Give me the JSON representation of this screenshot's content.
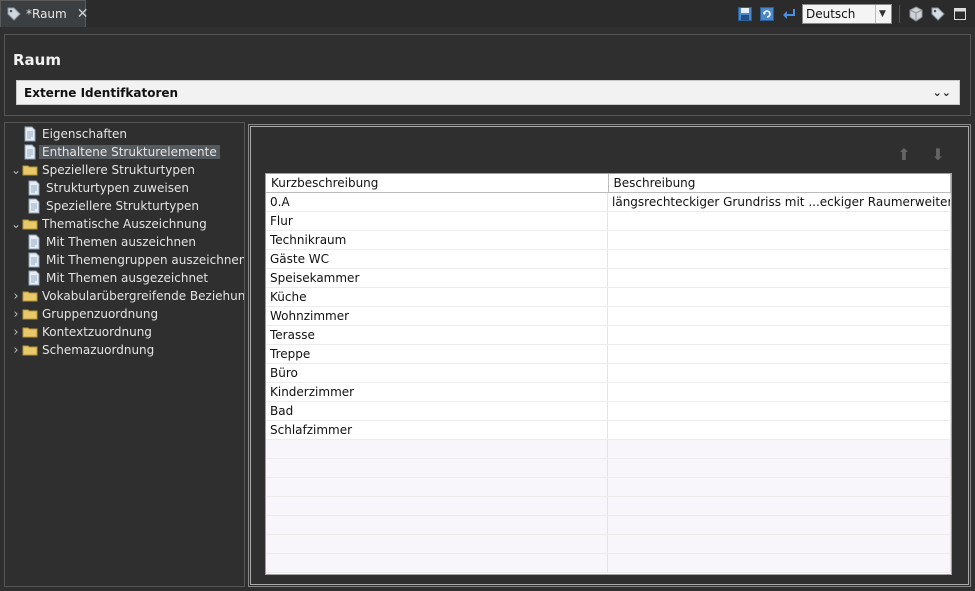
{
  "tab": {
    "title": "*Raum",
    "close_icon": "close-icon",
    "tag_icon": "tag-icon"
  },
  "toolbar": {
    "icons": [
      "save-icon",
      "refresh-icon",
      "undo-icon",
      "cube-icon",
      "tags-icon",
      "maximize-icon"
    ],
    "language": {
      "selected": "Deutsch"
    }
  },
  "header": {
    "title": "Raum",
    "section_label": "Externe Identifkatoren",
    "section_icon": "double-chevron-down-icon"
  },
  "tree": {
    "items": [
      {
        "label": "Eigenschaften",
        "icon": "document-icon",
        "level": 0,
        "twisty": ""
      },
      {
        "label": "Enthaltene Strukturelemente",
        "icon": "document-icon",
        "level": 0,
        "twisty": "",
        "selected": true
      },
      {
        "label": "Speziellere Strukturtypen",
        "icon": "folder-icon",
        "level": 0,
        "twisty": "expanded"
      },
      {
        "label": "Strukturtypen zuweisen",
        "icon": "document-icon",
        "level": 1,
        "twisty": ""
      },
      {
        "label": "Speziellere Strukturtypen",
        "icon": "document-icon",
        "level": 1,
        "twisty": ""
      },
      {
        "label": "Thematische Auszeichnung",
        "icon": "folder-icon",
        "level": 0,
        "twisty": "expanded"
      },
      {
        "label": "Mit Themen auszeichnen",
        "icon": "document-icon",
        "level": 1,
        "twisty": ""
      },
      {
        "label": "Mit Themengruppen auszeichnen",
        "icon": "document-icon",
        "level": 1,
        "twisty": ""
      },
      {
        "label": "Mit Themen ausgezeichnet",
        "icon": "document-icon",
        "level": 1,
        "twisty": ""
      },
      {
        "label": "Vokabularübergreifende Beziehungen",
        "icon": "folder-icon",
        "level": 0,
        "twisty": "collapsed"
      },
      {
        "label": "Gruppenzuordnung",
        "icon": "folder-icon",
        "level": 0,
        "twisty": "collapsed"
      },
      {
        "label": "Kontextzuordnung",
        "icon": "folder-icon",
        "level": 0,
        "twisty": "collapsed"
      },
      {
        "label": "Schemazuordnung",
        "icon": "folder-icon",
        "level": 0,
        "twisty": "collapsed"
      }
    ]
  },
  "main": {
    "move_up_icon": "arrow-up-icon",
    "move_down_icon": "arrow-down-icon",
    "table": {
      "columns": [
        "Kurzbeschreibung",
        "Beschreibung"
      ],
      "rows": [
        [
          "0.A",
          "längsrechteckiger Grundriss mit ...eckiger Raumerweiterung im O"
        ],
        [
          "Flur",
          ""
        ],
        [
          "Technikraum",
          ""
        ],
        [
          "Gäste WC",
          ""
        ],
        [
          "Speisekammer",
          ""
        ],
        [
          "Küche",
          ""
        ],
        [
          "Wohnzimmer",
          ""
        ],
        [
          "Terasse",
          ""
        ],
        [
          "Treppe",
          ""
        ],
        [
          "Büro",
          ""
        ],
        [
          "Kinderzimmer",
          ""
        ],
        [
          "Bad",
          ""
        ],
        [
          "Schlafzimmer",
          ""
        ]
      ]
    }
  }
}
